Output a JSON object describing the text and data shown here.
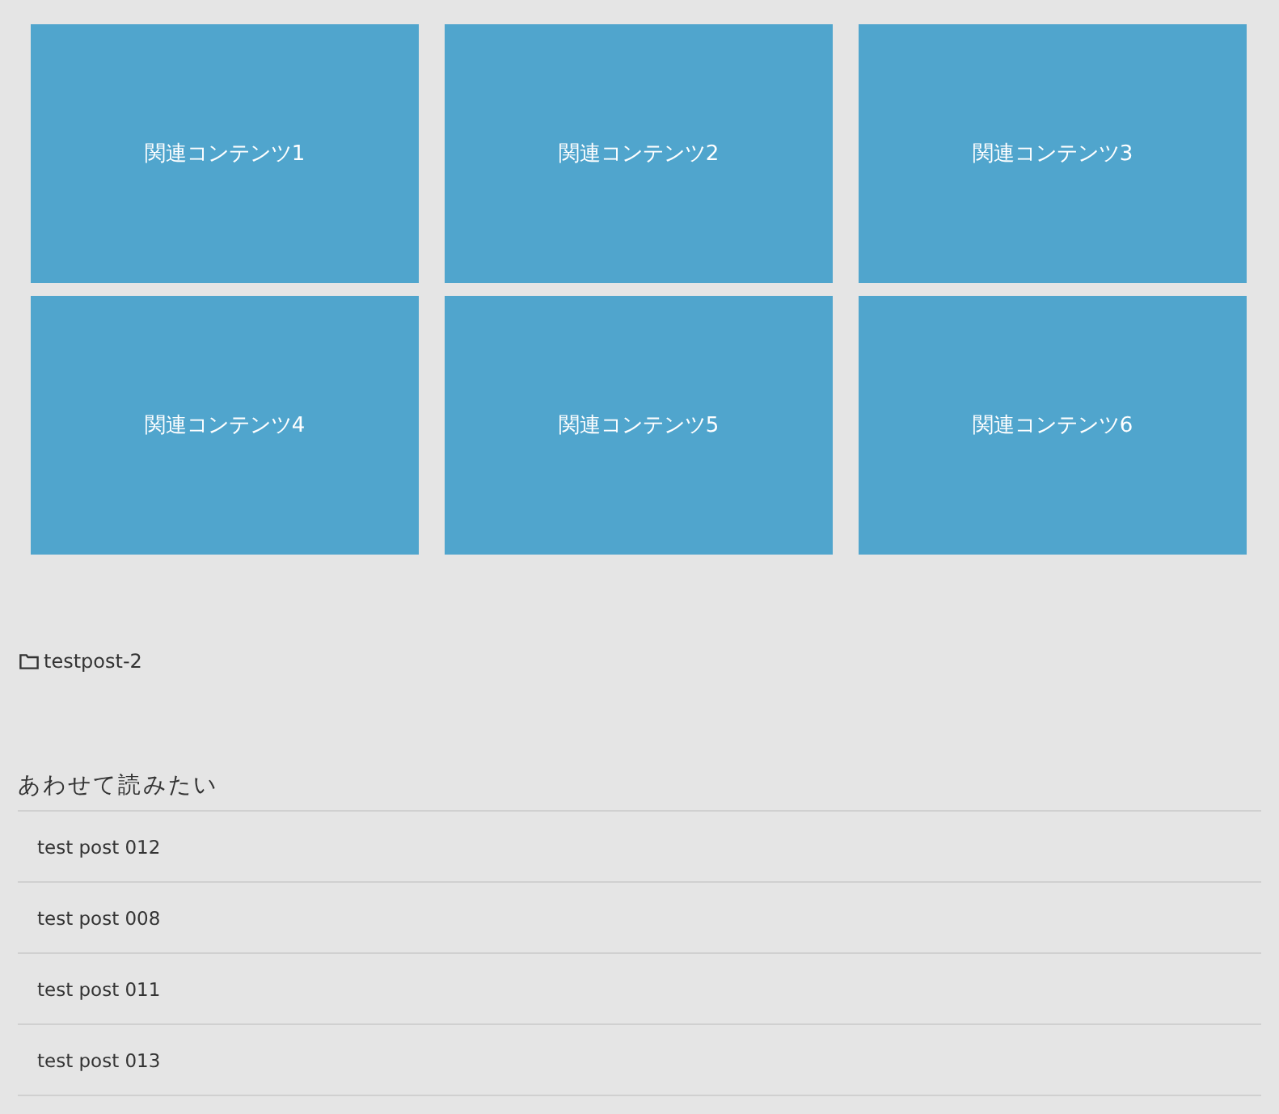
{
  "related_tiles": [
    {
      "label": "関連コンテンツ1"
    },
    {
      "label": "関連コンテンツ2"
    },
    {
      "label": "関連コンテンツ3"
    },
    {
      "label": "関連コンテンツ4"
    },
    {
      "label": "関連コンテンツ5"
    },
    {
      "label": "関連コンテンツ6"
    }
  ],
  "category": {
    "label": "testpost-2"
  },
  "related_posts": {
    "heading": "あわせて読みたい",
    "items": [
      {
        "title": "test post 012"
      },
      {
        "title": "test post 008"
      },
      {
        "title": "test post 011"
      },
      {
        "title": "test post 013"
      }
    ]
  }
}
